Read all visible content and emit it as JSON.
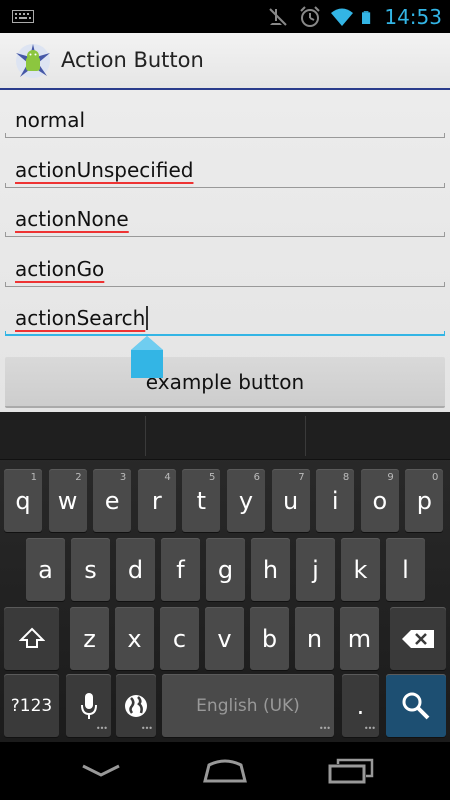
{
  "status_bar": {
    "time": "14:53",
    "accent": "#33b5e5",
    "icons": [
      "keyboard-icon",
      "mute-icon",
      "alarm-icon",
      "wifi-icon",
      "battery-icon"
    ]
  },
  "action_bar": {
    "title": "Action Button",
    "accent": "#2a3c8c"
  },
  "fields": [
    {
      "value": "normal"
    },
    {
      "value": "actionUnspecified"
    },
    {
      "value": "actionNone"
    },
    {
      "value": "actionGo"
    },
    {
      "value": "actionSearch"
    }
  ],
  "example_button": "example button",
  "keyboard": {
    "row1": [
      {
        "k": "q",
        "h": "1"
      },
      {
        "k": "w",
        "h": "2"
      },
      {
        "k": "e",
        "h": "3"
      },
      {
        "k": "r",
        "h": "4"
      },
      {
        "k": "t",
        "h": "5"
      },
      {
        "k": "y",
        "h": "6"
      },
      {
        "k": "u",
        "h": "7"
      },
      {
        "k": "i",
        "h": "8"
      },
      {
        "k": "o",
        "h": "9"
      },
      {
        "k": "p",
        "h": "0"
      }
    ],
    "row2": [
      "a",
      "s",
      "d",
      "f",
      "g",
      "h",
      "j",
      "k",
      "l"
    ],
    "row3": [
      "z",
      "x",
      "c",
      "v",
      "b",
      "n",
      "m"
    ],
    "symbols_key": "?123",
    "space_label": "English (UK)",
    "period_key": ".",
    "search_color": "#1d4f72"
  }
}
